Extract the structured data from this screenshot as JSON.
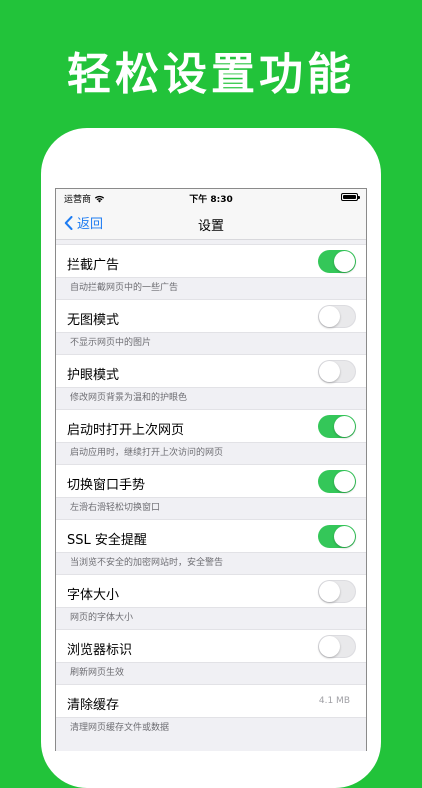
{
  "hero": {
    "title": "轻松设置功能"
  },
  "status_bar": {
    "carrier": "运营商",
    "time": "下午 8:30"
  },
  "nav": {
    "back_label": "返回",
    "title": "设置"
  },
  "colors": {
    "background": "#22c33a",
    "toggle_on": "#34c759",
    "accent": "#1e7cf2"
  },
  "settings": [
    {
      "label": "拦截广告",
      "control": "toggle",
      "on": true,
      "caption": "自动拦截网页中的一些广告"
    },
    {
      "label": "无图模式",
      "control": "toggle",
      "on": false,
      "caption": "不显示网页中的图片"
    },
    {
      "label": "护眼模式",
      "control": "toggle",
      "on": false,
      "caption": "修改网页背景为温和的护眼色"
    },
    {
      "label": "启动时打开上次网页",
      "control": "toggle",
      "on": true,
      "caption": "启动应用时，继续打开上次访问的网页"
    },
    {
      "label": "切换窗口手势",
      "control": "toggle",
      "on": true,
      "caption": "左滑右滑轻松切换窗口"
    },
    {
      "label": "SSL 安全提醒",
      "control": "toggle",
      "on": true,
      "caption": "当浏览不安全的加密网站时，安全警告"
    },
    {
      "label": "字体大小",
      "control": "toggle",
      "on": false,
      "caption": "网页的字体大小"
    },
    {
      "label": "浏览器标识",
      "control": "toggle",
      "on": false,
      "caption": "刷新网页生效"
    },
    {
      "label": "清除缓存",
      "control": "value",
      "value": "4.1 MB",
      "caption": "清理网页缓存文件或数据"
    }
  ]
}
